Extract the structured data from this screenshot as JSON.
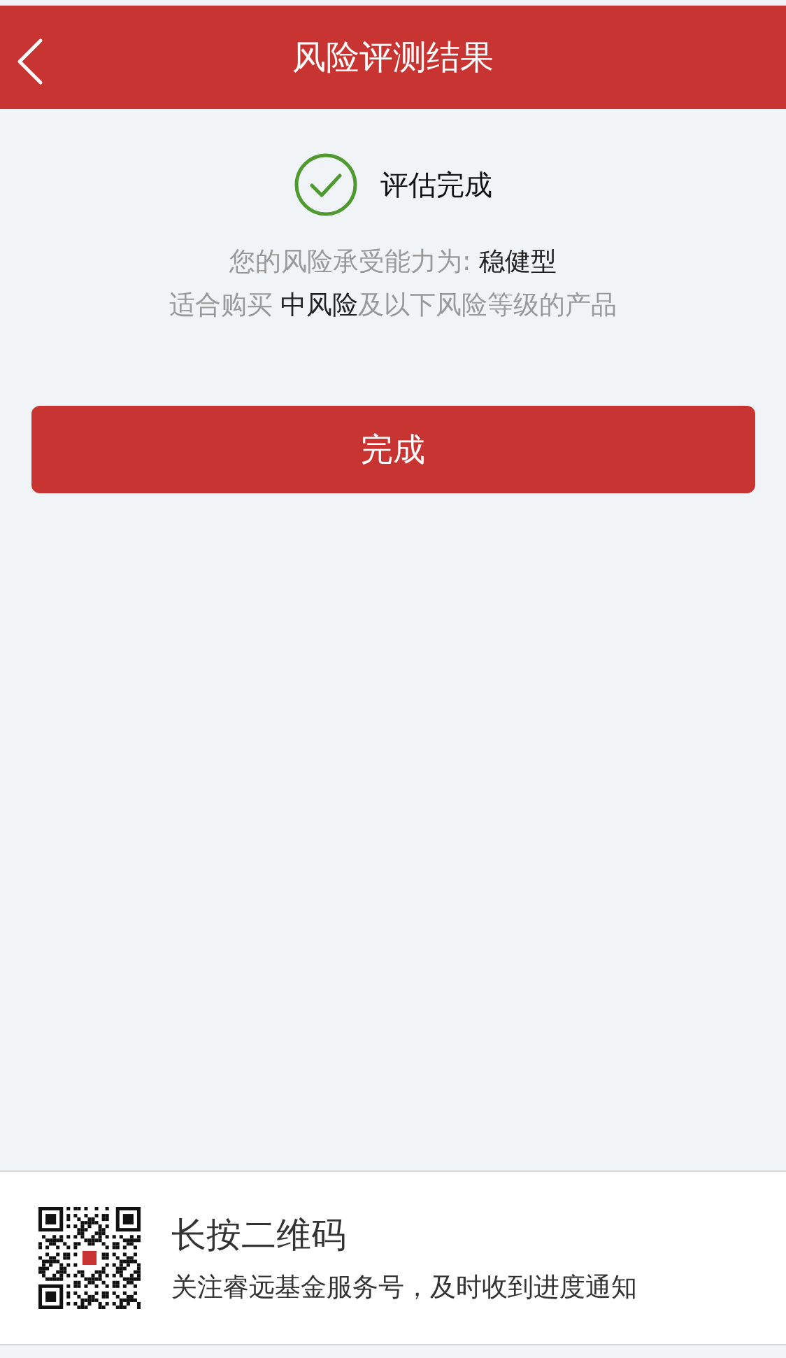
{
  "header": {
    "title": "风险评测结果",
    "back": true
  },
  "result": {
    "status": "评估完成",
    "complete": true,
    "lines": [
      "您的风险承受能力为: **稳健型**",
      "适合购买 **中风险**及以下风险等级的产品"
    ]
  },
  "button": {
    "label": "完成"
  },
  "footer": {
    "title": "长按二维码",
    "subtitle": "关注睿远基金服务号，及时收到进度通知"
  }
}
